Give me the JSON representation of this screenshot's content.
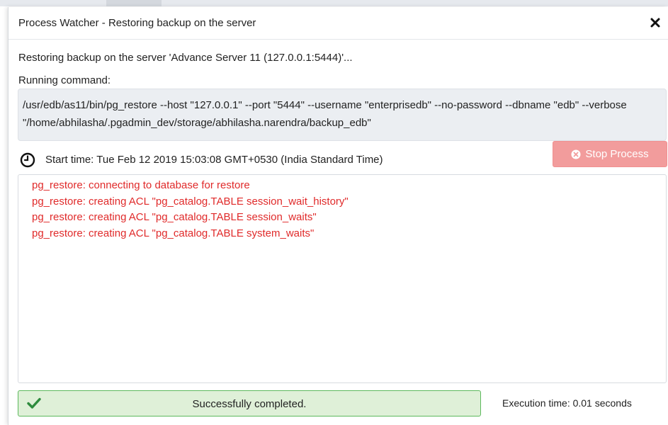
{
  "dialog": {
    "title": "Process Watcher - Restoring backup on the server",
    "close_icon": "close-icon"
  },
  "process": {
    "description": "Restoring backup on the server 'Advance Server 11 (127.0.0.1:5444)'...",
    "running_label": "Running command:",
    "command": "/usr/edb/as11/bin/pg_restore --host \"127.0.0.1\" --port \"5444\" --username \"enterprisedb\" --no-password --dbname \"edb\" --verbose \"/home/abhilasha/.pgadmin_dev/storage/abhilasha.narendra/backup_edb\"",
    "start_time": "Start time: Tue Feb 12 2019 15:03:08 GMT+0530 (India Standard Time)",
    "stop_button_label": "Stop Process"
  },
  "log": {
    "lines": [
      "pg_restore: connecting to database for restore",
      "pg_restore: creating ACL \"pg_catalog.TABLE session_wait_history\"",
      "pg_restore: creating ACL \"pg_catalog.TABLE session_waits\"",
      "pg_restore: creating ACL \"pg_catalog.TABLE system_waits\""
    ],
    "color": "#e02a2a"
  },
  "footer": {
    "status_text": "Successfully completed.",
    "execution_time": "Execution time: 0.01 seconds",
    "status_color": "#5cb85c"
  },
  "icons": {
    "clock": "clock-icon",
    "stop": "times-circle-icon",
    "success": "check-icon"
  }
}
